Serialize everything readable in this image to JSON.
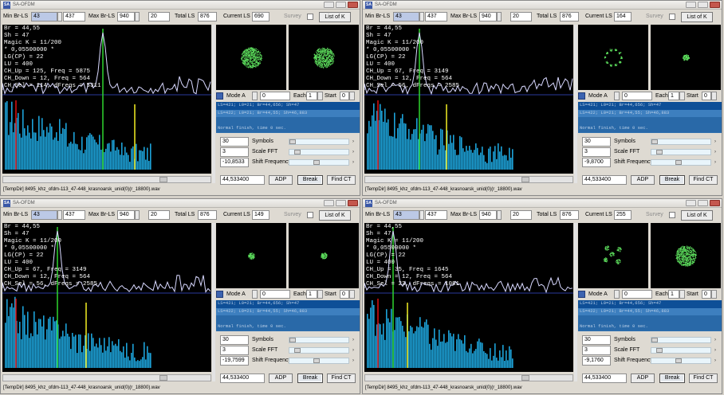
{
  "common": {
    "app_title": "SA-OFDM",
    "labels": {
      "min_br_ls": "Min Br-LS",
      "max_br_ls": "Max Br-LS",
      "total_ls": "Total LS",
      "current_ls": "Current LS",
      "survey": "Survey",
      "list_of_k": "List of K",
      "mode": "Mode A",
      "each": "Each",
      "start": "Start",
      "symbols": "Symbols",
      "scale_fft": "Scale FFT",
      "shift_frequency": "Shift Frequency",
      "adp": "ADP",
      "break": "Break",
      "find_ct": "Find CT"
    },
    "colors": {
      "window": "#dedad2",
      "log_bg": "#2f6fae",
      "log_sel": "#0e4f97",
      "spectrum_bars": "#1da2d8",
      "red_marker": "#e01010",
      "yellow_marker": "#f4ef23",
      "green_marker": "#2fd62f",
      "trace": "#d8d8ff",
      "constellation": "#5ee05e"
    },
    "icons": [
      "app-icon",
      "minimize-icon",
      "maximize-icon",
      "close-icon",
      "mode-icon"
    ]
  },
  "windows": [
    {
      "min_br": "43",
      "min_br_b": "437",
      "max_br": "940",
      "max_br_b": "20",
      "total_ls": "876",
      "current_ls": "690",
      "overlay": [
        "Br = 44,55",
        "Sh = 47",
        "Magic K = 11/200",
        "* 0,05500000 *",
        "LG(CP) = 22",
        "LU = 400",
        "CH_Up = 125, Freq = 5875",
        "CH_Down = 12, Freq = 564",
        "CH_Sel = 114, dFreqs = 5311"
      ],
      "mode_a": "0",
      "each": "1",
      "start": "0",
      "log": [
        "LS=421; L0=21; Br=44,656; Sh=47",
        "LS=422; L0=21; Br=44,55; Sh=46,883",
        "",
        "Normal finish, time 0 sec."
      ],
      "symbols": "30",
      "scale_fft": "3",
      "shift_freq": "-10,8533",
      "result": "44,533400",
      "status": "[TempDir] 8495_khz_ofdm-113_47-448_krasnoarsk_unid(0)(r_18800).wav"
    },
    {
      "min_br": "43",
      "min_br_b": "437",
      "max_br": "940",
      "max_br_b": "20",
      "total_ls": "876",
      "current_ls": "164",
      "overlay": [
        "Br = 44,55",
        "Sh = 47",
        "Magic K = 11/200",
        "* 0,05500000 *",
        "LG(CP) = 22",
        "LU = 400",
        "CH_Up = 67, Freq = 3149",
        "CH_Down = 12, Freq = 564",
        "CH_Sel = 56, dFreqs = 2585"
      ],
      "mode_a": "0",
      "each": "1",
      "start": "0",
      "log": [
        "LS=421; L0=21; Br=44,656; Sh=47",
        "LS=422; L0=21; Br=44,55; Sh=46,883",
        "",
        "Normal finish, time 0 sec."
      ],
      "symbols": "30",
      "scale_fft": "3",
      "shift_freq": "-9,8700",
      "result": "44,533400",
      "status": "[TempDir] 8495_khz_ofdm-113_47-448_krasnoarsk_unid(0)(r_18800).wav"
    },
    {
      "min_br": "43",
      "min_br_b": "437",
      "max_br": "940",
      "max_br_b": "20",
      "total_ls": "876",
      "current_ls": "149",
      "overlay": [
        "Br = 44,55",
        "Sh = 47",
        "Magic K = 11/200",
        "* 0,05500000 *",
        "LG(CP) = 22",
        "LU = 400",
        "CH_Up = 67, Freq = 3149",
        "CH_Down = 12, Freq = 564",
        "CH_Sel = 56, dFreqs = 2585"
      ],
      "mode_a": "0",
      "each": "1",
      "start": "0",
      "log": [
        "LS=421; L0=21; Br=44,656; Sh=47",
        "LS=422; L0=21; Br=44,55; Sh=46,883",
        "",
        "Normal finish, time 0 sec."
      ],
      "symbols": "30",
      "scale_fft": "3",
      "shift_freq": "-19,7599",
      "result": "44,533400",
      "status": "[TempDir] 8495_khz_ofdm-113_47-448_krasnoarsk_unid(0)(r_18800).wav"
    },
    {
      "min_br": "43",
      "min_br_b": "437",
      "max_br": "940",
      "max_br_b": "20",
      "total_ls": "876",
      "current_ls": "255",
      "overlay": [
        "Br = 44,55",
        "Sh = 47",
        "Magic K = 11/200",
        "* 0,05500000 *",
        "LG(CP) = 22",
        "LU = 400",
        "CH_Up = 35, Freq = 1645",
        "CH_Down = 12, Freq = 564",
        "CH_Sel = 23, dFreqs = 1081"
      ],
      "mode_a": "0",
      "each": "1",
      "start": "0",
      "log": [
        "LS=421; L0=21; Br=44,656; Sh=47",
        "LS=422; L0=21; Br=44,55; Sh=46,883",
        "",
        "Normal finish, time 0 sec."
      ],
      "symbols": "30",
      "scale_fft": "3",
      "shift_freq": "-9,1760",
      "result": "44,533400",
      "status": "[TempDir] 8495_khz_ofdm-113_47-448_krasnoarsk_unid(0)(r_18800).wav"
    }
  ]
}
